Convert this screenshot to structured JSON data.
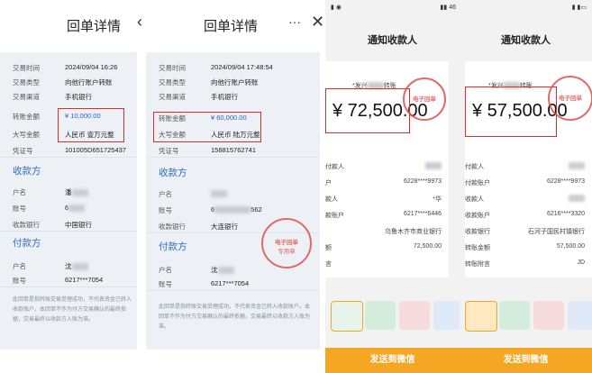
{
  "panel1": {
    "title": "回单详情",
    "rows": [
      {
        "label": "交易时间",
        "value": "2024/09/04 16:26"
      },
      {
        "label": "交易类型",
        "value": "向他行账户转账"
      },
      {
        "label": "交易渠道",
        "value": "手机银行"
      },
      {
        "label": "转账金额",
        "value": "¥ 10,000.00"
      },
      {
        "label": "大写金额",
        "value": "人民币 壹万元整"
      },
      {
        "label": "凭证号",
        "value": "101005D651725437"
      }
    ],
    "payee_title": "收款方",
    "payee_rows": [
      {
        "label": "户名",
        "value": "潘"
      },
      {
        "label": "账号",
        "value": "6"
      },
      {
        "label": "收款银行",
        "value": "中国银行"
      }
    ],
    "payer_title": "付款方",
    "payer_rows": [
      {
        "label": "户名",
        "value": "沈"
      },
      {
        "label": "账号",
        "value": "6217***7054"
      }
    ],
    "note": "此回单是指转账交易受理成功，不代表资金已转入收款账户。本回单不作为付方交易确认的最终依据，交易最终以收款方入账为准。"
  },
  "panel2": {
    "title": "回单详情",
    "back_icon": "chevron-left-icon",
    "more_icon": "more-icon",
    "close_icon": "close-icon",
    "rows": [
      {
        "label": "交易时间",
        "value": "2024/09/04 17:48:54"
      },
      {
        "label": "交易类型",
        "value": "向他行账户转账"
      },
      {
        "label": "交易渠道",
        "value": "手机银行"
      },
      {
        "label": "转账金额",
        "value": "¥ 60,000.00"
      },
      {
        "label": "大写金额",
        "value": "人民币 陆万元整"
      },
      {
        "label": "凭证号",
        "value": "158815762741"
      }
    ],
    "payee_title": "收款方",
    "payee_rows": [
      {
        "label": "户名",
        "value": ""
      },
      {
        "label": "账号",
        "value": "6"
      },
      {
        "label": "收款银行",
        "value": "大连银行"
      }
    ],
    "payer_title": "付款方",
    "payer_rows": [
      {
        "label": "户名",
        "value": "沈"
      },
      {
        "label": "账号",
        "value": "6217***7054"
      }
    ],
    "account_suffix": "562",
    "note": "此回单是指转账交易受理成功，不代表资金已转入收款账户。本回单不作为付方交易确认的最终依据，交易最终以收款方入账为准。",
    "stamp_line1": "电子回单",
    "stamp_line2": "专用章"
  },
  "panel3": {
    "title": "通知收款人",
    "status_right": "46",
    "sender": "*发兴",
    "sender_suffix": "转账",
    "amount": "¥ 72,500.00",
    "rows": [
      {
        "label": "付款人",
        "value": ""
      },
      {
        "label": "户",
        "value": "6228****9973"
      },
      {
        "label": "款人",
        "value": "*华"
      },
      {
        "label": "款账户",
        "value": "6217****6446"
      },
      {
        "label": "",
        "value": "乌鲁木齐市商业银行"
      },
      {
        "label": "额",
        "value": "72,500.00"
      },
      {
        "label": "言",
        "value": ""
      }
    ],
    "send_label": "发送到微信"
  },
  "panel4": {
    "title": "通知收款人",
    "sender": "*发兴",
    "sender_suffix": "转账",
    "amount": "¥ 57,500.00",
    "rows": [
      {
        "label": "付款人",
        "value": ""
      },
      {
        "label": "付款账户",
        "value": "6228****9973"
      },
      {
        "label": "收款人",
        "value": ""
      },
      {
        "label": "收款账户",
        "value": "6216****3320"
      },
      {
        "label": "收款银行",
        "value": "石河子国民村镇银行"
      },
      {
        "label": "转账金额",
        "value": "57,500.00"
      },
      {
        "label": "转账附言",
        "value": "JD"
      }
    ],
    "send_label": "发送到微信"
  }
}
